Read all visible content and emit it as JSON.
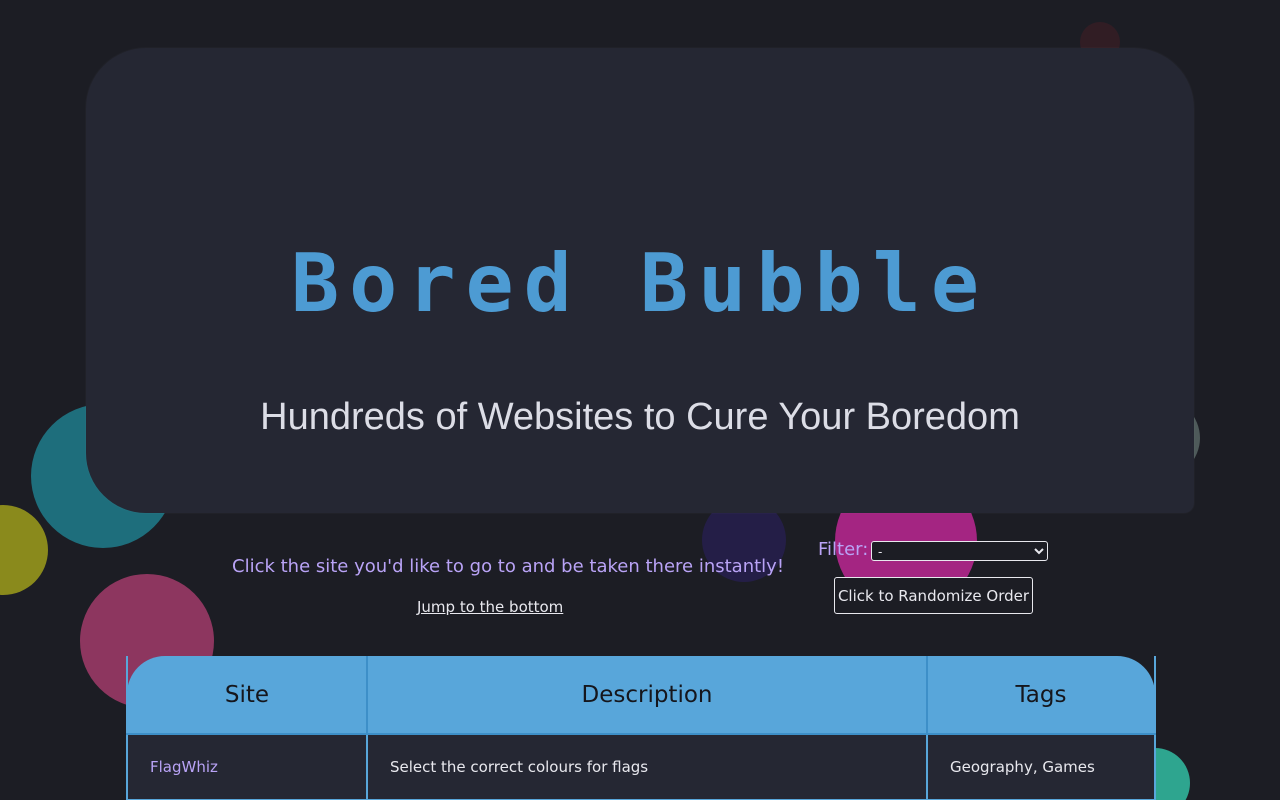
{
  "header": {
    "title": "Bored Bubble",
    "subtitle": "Hundreds of Websites to Cure Your Boredom"
  },
  "intro": {
    "instructions": "Click the site you'd like to go to and be taken there instantly!",
    "jump_link": "Jump to the bottom"
  },
  "controls": {
    "filter_label": "Filter:",
    "filter_selected": "-",
    "randomize_label": "Click to Randomize Order"
  },
  "table": {
    "columns": [
      "Site",
      "Description",
      "Tags"
    ],
    "rows": [
      {
        "site": "FlagWhiz",
        "description": "Select the correct colours for flags",
        "tags": "Geography, Games"
      }
    ]
  },
  "colors": {
    "background": "#1c1d24",
    "panel": "#252733",
    "accent_blue": "#58a6da",
    "title_blue": "#4d9bd3",
    "accent_purple": "#b9a3f6"
  }
}
